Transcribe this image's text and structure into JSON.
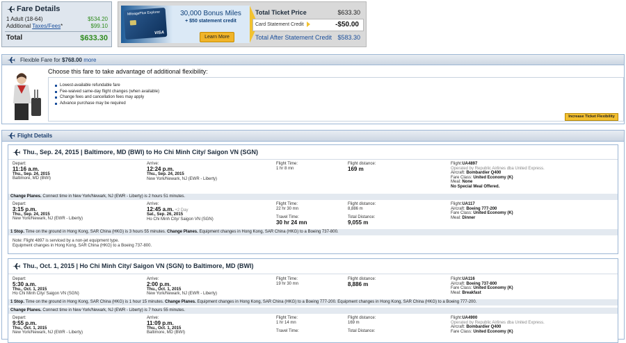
{
  "fare_details": {
    "title": "Fare Details",
    "adult_label": "1 Adult (18-64)",
    "adult_amount": "$534.20",
    "additional_prefix": "Additional ",
    "taxes_link": "Taxes/Fees",
    "taxes_suffix": "*",
    "taxes_amount": "$99.10",
    "total_label": "Total",
    "total_amount": "$633.30"
  },
  "promo": {
    "card_name": "MileagePlus Explorer",
    "card_visa": "VISA",
    "headline": "30,000 Bonus Miles",
    "subline": "+ $50 statement credit",
    "learn_more": "Learn More",
    "total_ticket_label": "Total Ticket Price",
    "total_ticket_value": "$633.30",
    "credit_label": "Card Statement Credit",
    "credit_value": "-$50.00",
    "after_label": "Total After Statement Credit",
    "after_value": "$583.30"
  },
  "flexible": {
    "header_prefix": "Flexible Fare for ",
    "header_amount": "$768.00",
    "header_more": "more",
    "question": "Choose this fare to take advantage of additional flexibility:",
    "benefits": [
      "Lowest-available refundable fare",
      "Fee-waived same-day flight changes (when available)",
      "Change fees and cancellation fees may apply",
      "Advance purchase may be required"
    ],
    "button": "Increase Ticket Flexibility"
  },
  "flight_details": {
    "title": "Flight Details",
    "segments": [
      {
        "title": "Thu., Sep. 24, 2015 | Baltimore, MD (BWI) to Ho Chi Minh City/ Saigon VN (SGN)",
        "legs": [
          {
            "depart_label": "Depart:",
            "depart_time": "11:16 a.m.",
            "depart_date": "Thu., Sep. 24, 2015",
            "depart_airport": "Baltimore, MD (BWI)",
            "arrive_label": "Arrive:",
            "arrive_time": "12:24 p.m.",
            "arrive_extra": "",
            "arrive_date": "Thu., Sep. 24, 2015",
            "arrive_airport": "New York/Newark, NJ (EWR - Liberty)",
            "ftime_label": "Flight Time:",
            "ftime": "1 hr 8 mn",
            "ttime_label": "",
            "ttime": "",
            "dist_label": "Flight distance:",
            "dist": "169 m",
            "tdist_label": "",
            "tdist": "",
            "flight_label": "Flight:",
            "flight": "UA4897",
            "operated": "Operated by Republic Airlines dba United Express.",
            "aircraft_label": "Aircraft: ",
            "aircraft": "Bombardier Q400",
            "fare_label": "Fare Class: ",
            "fare": "United Economy (K)",
            "meal_label": "Meal: ",
            "meal": "None",
            "meal_extra": "No Special Meal Offered."
          },
          {
            "depart_label": "Depart:",
            "depart_time": "3:15 p.m.",
            "depart_date": "Thu., Sep. 24, 2015",
            "depart_airport": "New York/Newark, NJ (EWR - Liberty)",
            "arrive_label": "Arrive:",
            "arrive_time": "12:45 a.m.",
            "arrive_extra": " +2 Day",
            "arrive_date": "Sat., Sep. 26, 2015",
            "arrive_airport": "Ho Chi Minh City/ Saigon VN (SGN)",
            "ftime_label": "Flight Time:",
            "ftime": "22 hr 30 mn",
            "ttime_label": "Travel Time:",
            "ttime": "30 hr 24 mn",
            "dist_label": "Flight distance:",
            "dist": "8,886 m",
            "tdist_label": "Total Distance:",
            "tdist": "9,055 m",
            "flight_label": "Flight:",
            "flight": "UA117",
            "operated": "",
            "aircraft_label": "Aircraft: ",
            "aircraft": "Boeing 777-200",
            "fare_label": "Fare Class: ",
            "fare": "United Economy (K)",
            "meal_label": "Meal: ",
            "meal": "Dinner",
            "meal_extra": ""
          }
        ],
        "change_planes": {
          "bold": "Change Planes.",
          "text": " Connect time in New York/Newark, NJ (EWR - Liberty) is 2 hours 51 minutes."
        },
        "stop": {
          "bold": "1 Stop.",
          "text": " Time on the ground in Hong Kong, SAR China (HKG) is 3 hours 55 minutes. ",
          "bold2": "Change Planes.",
          "text2": " Equipment changes in Hong Kong, SAR China (HKG) to a Boeing 737-800."
        },
        "notes": [
          "Note: Flight 4897 is serviced by a non-jet equipment type.",
          "Equipment changes in Hong Kong, SAR China (HKG) to a Boeing 737-800."
        ]
      },
      {
        "title": "Thu., Oct. 1, 2015 | Ho Chi Minh City/ Saigon VN (SGN) to Baltimore, MD (BWI)",
        "legs": [
          {
            "depart_label": "Depart:",
            "depart_time": "5:30 a.m.",
            "depart_date": "Thu., Oct. 1, 2015",
            "depart_airport": "Ho Chi Minh City/ Saigon VN (SGN)",
            "arrive_label": "Arrive:",
            "arrive_time": "2:00 p.m.",
            "arrive_extra": "",
            "arrive_date": "Thu., Oct. 1, 2015",
            "arrive_airport": "New York/Newark, NJ (EWR - Liberty)",
            "ftime_label": "Flight Time:",
            "ftime": "19 hr 30 mn",
            "ttime_label": "",
            "ttime": "",
            "dist_label": "Flight distance:",
            "dist": "8,886 m",
            "tdist_label": "",
            "tdist": "",
            "flight_label": "Flight:",
            "flight": "UA116",
            "operated": "",
            "aircraft_label": "Aircraft: ",
            "aircraft": "Boeing 737-800",
            "fare_label": "Fare Class: ",
            "fare": "United Economy (K)",
            "meal_label": "Meal: ",
            "meal": "Breakfast",
            "meal_extra": ""
          },
          {
            "depart_label": "Depart:",
            "depart_time": "9:55 p.m.",
            "depart_date": "Thu., Oct. 1, 2015",
            "depart_airport": "New York/Newark, NJ (EWR - Liberty)",
            "arrive_label": "Arrive:",
            "arrive_time": "11:09 p.m.",
            "arrive_extra": "",
            "arrive_date": "Thu., Oct. 1, 2015",
            "arrive_airport": "Baltimore, MD (BWI)",
            "ftime_label": "Flight Time:",
            "ftime": "1 hr 14 mn",
            "ttime_label": "Travel Time:",
            "ttime": "",
            "dist_label": "Flight distance:",
            "dist": "169 m",
            "tdist_label": "Total Distance:",
            "tdist": "",
            "flight_label": "Flight:",
            "flight": "UA4900",
            "operated": "Operated by Republic Airlines dba United Express.",
            "aircraft_label": "Aircraft: ",
            "aircraft": "Bombardier Q400",
            "fare_label": "Fare Class: ",
            "fare": "United Economy (K)",
            "meal_label": "",
            "meal": "",
            "meal_extra": ""
          }
        ],
        "stop": {
          "bold": "1 Stop.",
          "text": " Time on the ground in Hong Kong, SAR China (HKG) is 1 hour 15 minutes. ",
          "bold2": "Change Planes.",
          "text2": " Equipment changes in Hong Kong, SAR China (HKG) to a Boeing 777-200. Equipment changes in Hong Kong, SAR China (HKG) to a Boeing 777-200."
        },
        "change_planes": {
          "bold": "Change Planes.",
          "text": " Connect time in New York/Newark, NJ (EWR - Liberty) is 7 hours 55 minutes."
        }
      }
    ]
  },
  "colors": {
    "accent": "#1a4e9b",
    "price_green": "#2e8b1c",
    "button_yellow": "#f3c030",
    "bar_blue": "#ccd6e2"
  }
}
